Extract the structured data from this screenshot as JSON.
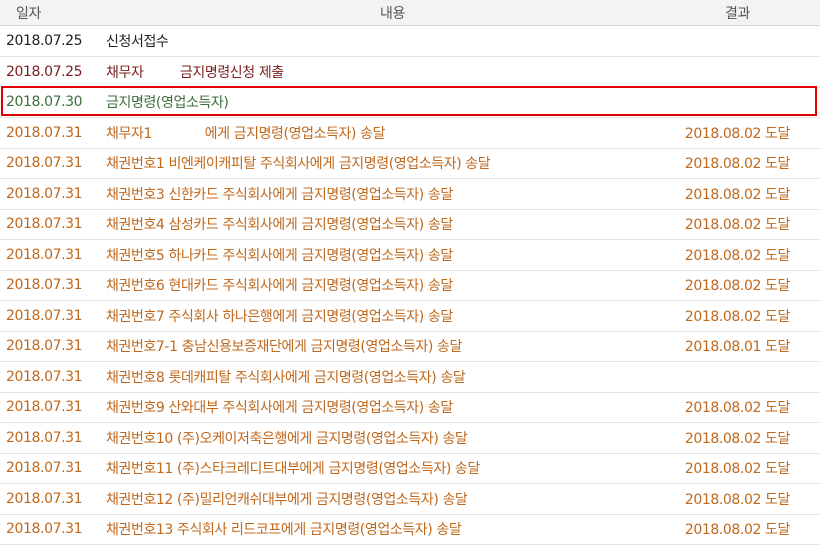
{
  "header": {
    "date": "일자",
    "content": "내용",
    "result": "결과"
  },
  "rows": [
    {
      "date": "2018.07.25",
      "content": "신청서접수",
      "result": "",
      "color": "black"
    },
    {
      "date": "2018.07.25",
      "content": "채무자         금지명령신청 제출",
      "result": "",
      "color": "maroon"
    },
    {
      "date": "2018.07.30",
      "content": "금지명령(영업소득자)",
      "result": "",
      "color": "green",
      "highlighted": true
    },
    {
      "date": "2018.07.31",
      "content": "채무자1             에게 금지명령(영업소득자) 송달",
      "result": "2018.08.02 도달",
      "color": "orange"
    },
    {
      "date": "2018.07.31",
      "content": "채권번호1 비엔케이캐피탈 주식회사에게 금지명령(영업소득자) 송달",
      "result": "2018.08.02 도달",
      "color": "orange"
    },
    {
      "date": "2018.07.31",
      "content": "채권번호3 신한카드 주식회사에게 금지명령(영업소득자) 송달",
      "result": "2018.08.02 도달",
      "color": "orange"
    },
    {
      "date": "2018.07.31",
      "content": "채권번호4 삼성카드 주식회사에게 금지명령(영업소득자) 송달",
      "result": "2018.08.02 도달",
      "color": "orange"
    },
    {
      "date": "2018.07.31",
      "content": "채권번호5 하나카드 주식회사에게 금지명령(영업소득자) 송달",
      "result": "2018.08.02 도달",
      "color": "orange"
    },
    {
      "date": "2018.07.31",
      "content": "채권번호6 현대카드 주식회사에게 금지명령(영업소득자) 송달",
      "result": "2018.08.02 도달",
      "color": "orange"
    },
    {
      "date": "2018.07.31",
      "content": "채권번호7 주식회사 하나은행에게 금지명령(영업소득자) 송달",
      "result": "2018.08.02 도달",
      "color": "orange"
    },
    {
      "date": "2018.07.31",
      "content": "채권번호7-1 충남신용보증재단에게 금지명령(영업소득자) 송달",
      "result": "2018.08.01 도달",
      "color": "orange"
    },
    {
      "date": "2018.07.31",
      "content": "채권번호8 롯데캐피탈 주식회사에게 금지명령(영업소득자) 송달",
      "result": "",
      "color": "orange"
    },
    {
      "date": "2018.07.31",
      "content": "채권번호9 산와대부 주식회사에게 금지명령(영업소득자) 송달",
      "result": "2018.08.02 도달",
      "color": "orange"
    },
    {
      "date": "2018.07.31",
      "content": "채권번호10 (주)오케이저축은행에게 금지명령(영업소득자) 송달",
      "result": "2018.08.02 도달",
      "color": "orange"
    },
    {
      "date": "2018.07.31",
      "content": "채권번호11 (주)스타크레디트대부에게 금지명령(영업소득자) 송달",
      "result": "2018.08.02 도달",
      "color": "orange"
    },
    {
      "date": "2018.07.31",
      "content": "채권번호12 (주)밀리언캐쉬대부에게 금지명령(영업소득자) 송달",
      "result": "2018.08.02 도달",
      "color": "orange"
    },
    {
      "date": "2018.07.31",
      "content": "채권번호13 주식회사 리드코프에게 금지명령(영업소득자) 송달",
      "result": "2018.08.02 도달",
      "color": "orange"
    }
  ]
}
